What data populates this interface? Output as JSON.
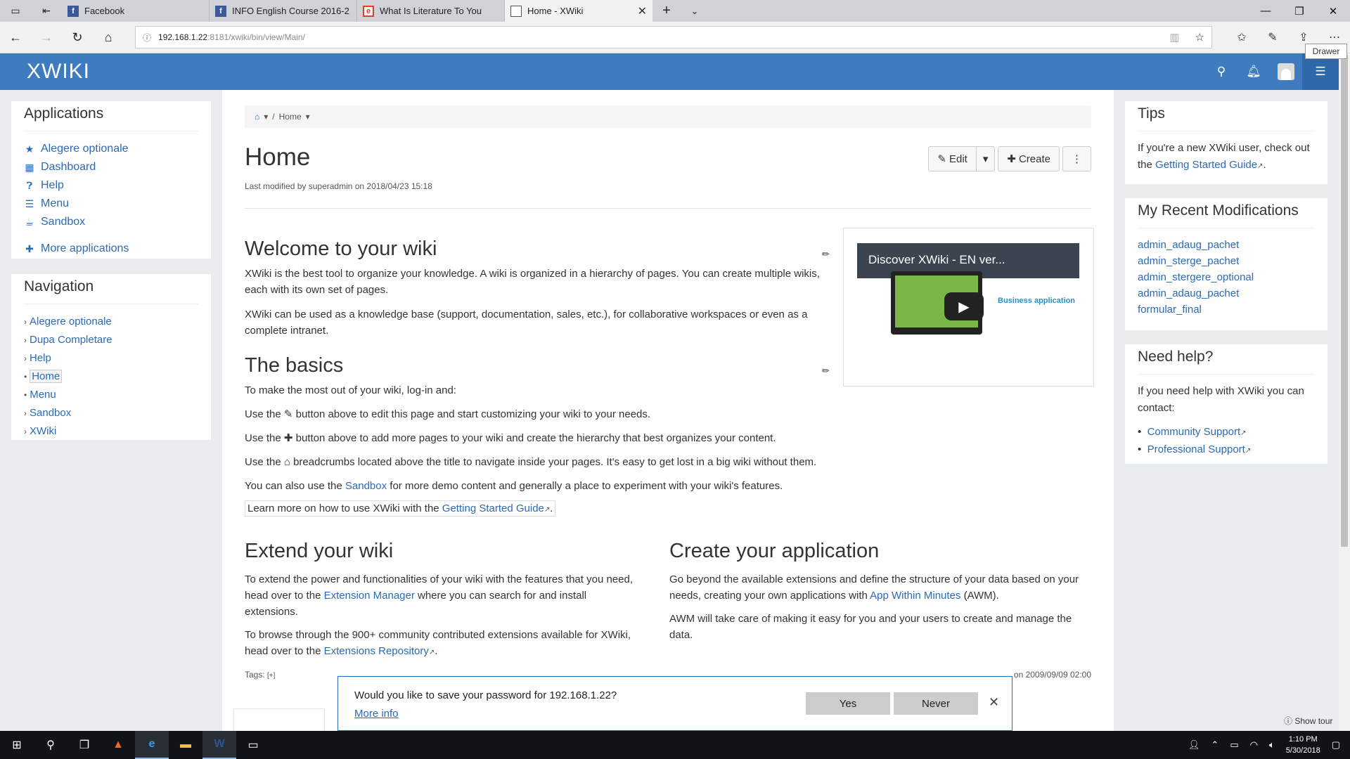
{
  "browser": {
    "tabs": [
      {
        "title": "Facebook",
        "favicon": "facebook-icon",
        "color": "#3b5998"
      },
      {
        "title": "INFO English Course 2016-2",
        "favicon": "facebook-icon",
        "color": "#3b5998"
      },
      {
        "title": "What Is Literature To You",
        "favicon": "e-icon",
        "color": "#e23d28"
      },
      {
        "title": "Home - XWiki",
        "favicon": "page-icon",
        "color": "#555555"
      }
    ],
    "url_host": "192.168.1.22",
    "url_rest": ":8181/xwiki/bin/view/Main/",
    "drawer_tooltip": "Drawer"
  },
  "header": {
    "logo": "XWIKI",
    "brand_color": "#3e7cbf"
  },
  "left": {
    "applications": {
      "title": "Applications",
      "items": [
        {
          "label": "Alegere optionale",
          "icon": "star-icon"
        },
        {
          "label": "Dashboard",
          "icon": "dashboard-icon"
        },
        {
          "label": "Help",
          "icon": "question-icon"
        },
        {
          "label": "Menu",
          "icon": "list-icon"
        },
        {
          "label": "Sandbox",
          "icon": "coffee-icon"
        }
      ],
      "more": "More applications"
    },
    "navigation": {
      "title": "Navigation",
      "items": [
        "Alegere optionale",
        "Dupa Completare",
        "Help",
        "Home",
        "Menu",
        "Sandbox",
        "XWiki"
      ]
    }
  },
  "main": {
    "breadcrumb": "Home",
    "title": "Home",
    "modified": "Last modified by superadmin on 2018/04/23 15:18",
    "buttons": {
      "edit": "Edit",
      "create": "Create"
    },
    "welcome": {
      "heading": "Welcome to your wiki",
      "p1": "XWiki is the best tool to organize your knowledge. A wiki is organized in a hierarchy of pages. You can create multiple wikis, each with its own set of pages.",
      "p2": "XWiki can be used as a knowledge base (support, documentation, sales, etc.), for collaborative workspaces or even as a complete intranet."
    },
    "basics": {
      "heading": "The basics",
      "intro": "To make the most out of your wiki, log-in and:",
      "edit_line": "Use the ✎ button above to edit this page and start customizing your wiki to your needs.",
      "add_line": "Use the ✚ button above to add more pages to your wiki and create the hierarchy that best organizes your content.",
      "nav_line": "Use the ⌂ breadcrumbs located above the title to navigate inside your pages. It's easy to get lost in a big wiki without them.",
      "sandbox_pre": "You can also use the ",
      "sandbox_link": "Sandbox",
      "sandbox_post": " for more demo content and generally a place to experiment with your wiki's features.",
      "learn_pre": "Learn more on how to use XWiki with the ",
      "learn_link": "Getting Started Guide",
      "learn_post": "."
    },
    "video": {
      "title": "Discover XWiki - EN ver...",
      "side_text": "Business application"
    },
    "extend": {
      "heading": "Extend your wiki",
      "p1_pre": "To extend the power and functionalities of your wiki with the features that you need, head over to the ",
      "p1_link": "Extension Manager",
      "p1_post": " where you can search for and install extensions.",
      "p2_pre": "To browse through the 900+ community contributed extensions available for XWiki, head over to the ",
      "p2_link": "Extensions Repository",
      "p2_post": "."
    },
    "create": {
      "heading": "Create your application",
      "p1_pre": "Go beyond the available extensions and define the structure of your data based on your needs, creating your own applications with ",
      "p1_link": "App Within Minutes",
      "p1_post": " (AWM).",
      "p2": "AWM will take care of making it easy for you and your users to create and manage the data."
    },
    "tags": "Tags:",
    "tags_add": "[+]",
    "footer_date": "on 2009/09/09 02:00"
  },
  "right": {
    "tips": {
      "title": "Tips",
      "pre": "If you're a new XWiki user, check out the ",
      "link": "Getting Started Guide",
      "post": "."
    },
    "recent": {
      "title": "My Recent Modifications",
      "items": [
        "admin_adaug_pachet",
        "admin_sterge_pachet",
        "admin_stergere_optional",
        "admin_adaug_pachet",
        "formular_final"
      ]
    },
    "help": {
      "title": "Need help?",
      "text": "If you need help with XWiki you can contact:",
      "links": [
        "Community Support",
        "Professional Support"
      ]
    }
  },
  "password_prompt": {
    "question": "Would you like to save your password for 192.168.1.22?",
    "more": "More info",
    "yes": "Yes",
    "never": "Never"
  },
  "show_tour": "Show tour",
  "taskbar": {
    "time": "1:10 PM",
    "date": "5/30/2018"
  }
}
